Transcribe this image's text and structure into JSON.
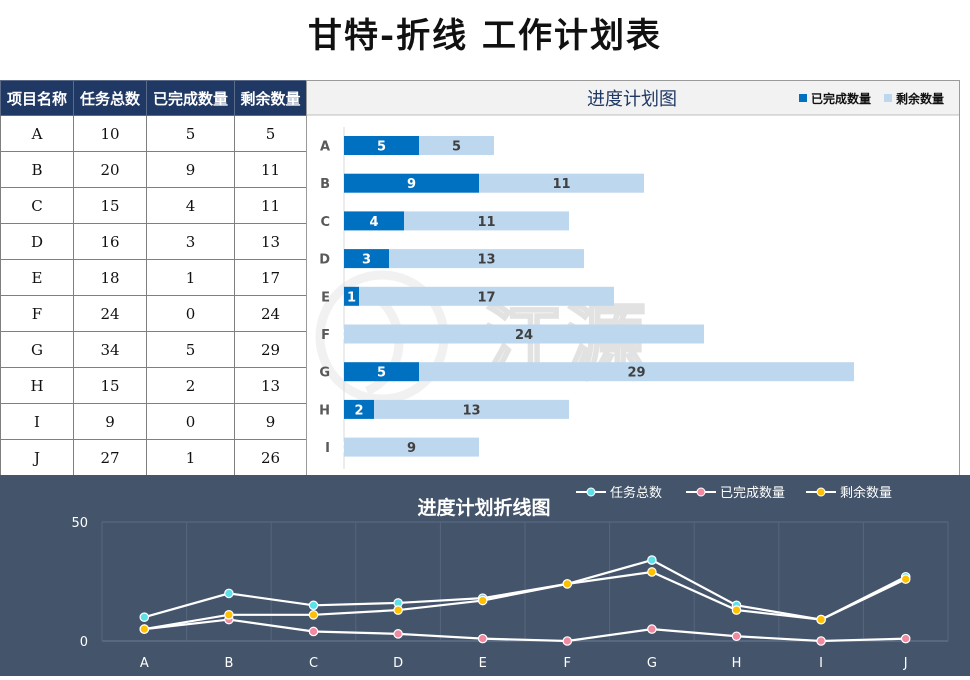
{
  "page": {
    "title": "甘特-折线  工作计划表"
  },
  "table": {
    "headers": [
      "项目名称",
      "任务总数",
      "已完成数量",
      "剩余数量"
    ],
    "rows": [
      [
        "A",
        "10",
        "5",
        "5"
      ],
      [
        "B",
        "20",
        "9",
        "11"
      ],
      [
        "C",
        "15",
        "4",
        "11"
      ],
      [
        "D",
        "16",
        "3",
        "13"
      ],
      [
        "E",
        "18",
        "1",
        "17"
      ],
      [
        "F",
        "24",
        "0",
        "24"
      ],
      [
        "G",
        "34",
        "5",
        "29"
      ],
      [
        "H",
        "15",
        "2",
        "13"
      ],
      [
        "I",
        "9",
        "0",
        "9"
      ],
      [
        "J",
        "27",
        "1",
        "26"
      ]
    ]
  },
  "watermark": {
    "text": "江源"
  },
  "chart_data": [
    {
      "type": "bar",
      "orientation": "horizontal",
      "stacked": true,
      "title": "进度计划图",
      "categories": [
        "A",
        "B",
        "C",
        "D",
        "E",
        "F",
        "G",
        "H",
        "I"
      ],
      "series": [
        {
          "name": "已完成数量",
          "values": [
            5,
            9,
            4,
            3,
            1,
            0,
            5,
            2,
            0
          ],
          "color": "#0070c0"
        },
        {
          "name": "剩余数量",
          "values": [
            5,
            11,
            11,
            13,
            17,
            24,
            29,
            13,
            9
          ],
          "color": "#bdd7ee"
        }
      ],
      "legend": "top-right",
      "data_labels": true
    },
    {
      "type": "line",
      "title": "进度计划折线图",
      "categories": [
        "A",
        "B",
        "C",
        "D",
        "E",
        "F",
        "G",
        "H",
        "I",
        "J"
      ],
      "series": [
        {
          "name": "任务总数",
          "values": [
            10,
            20,
            15,
            16,
            18,
            24,
            34,
            15,
            9,
            27
          ],
          "color": "#5ee0e8"
        },
        {
          "name": "已完成数量",
          "values": [
            5,
            9,
            4,
            3,
            1,
            0,
            5,
            2,
            0,
            1
          ],
          "color": "#f08aa2"
        },
        {
          "name": "剩余数量",
          "values": [
            5,
            11,
            11,
            13,
            17,
            24,
            29,
            13,
            9,
            26
          ],
          "color": "#ffc000"
        }
      ],
      "y_ticks": [
        "0",
        "50"
      ],
      "ylim": [
        0,
        50
      ],
      "background": "#44546a",
      "legend": "top-right",
      "grid": true
    }
  ]
}
